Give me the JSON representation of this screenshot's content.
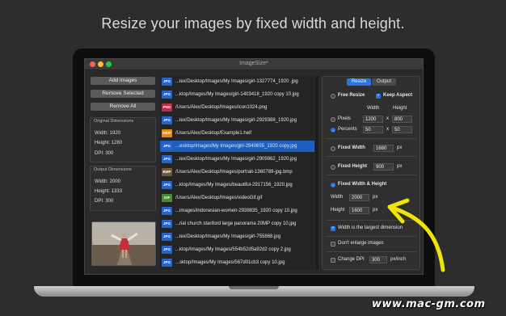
{
  "headline": "Resize your images by fixed width and height.",
  "window": {
    "title": "ImageSize*"
  },
  "buttons": {
    "add": "Add Images",
    "remove_selected": "Remove Selected",
    "remove_all": "Remove All"
  },
  "original": {
    "title": "Original Dimensions",
    "width": "Width: 1920",
    "height": "Height: 1280",
    "dpi": "DPI: 300"
  },
  "output": {
    "title": "Output Dimensions",
    "width": "Width: 2000",
    "height": "Height: 1333",
    "dpi": "DPI: 300"
  },
  "files": [
    {
      "type": "JPG",
      "path": "...lex/Desktop/Images/My Images/girl-1327774_1920 .jpg",
      "color": "#2b63c7"
    },
    {
      "type": "JPG",
      "path": "...ktop/Images/My Images/girl-1403418_1920 copy 10.jpg",
      "color": "#2b63c7"
    },
    {
      "type": "PNG",
      "path": "/Users/Alex/Desktop/Images/icon1024.png",
      "color": "#b8314a"
    },
    {
      "type": "JPG",
      "path": "...lex/Desktop/Images/My Images/girl-2929388_1920.jpg",
      "color": "#2b63c7"
    },
    {
      "type": "HEIF",
      "path": "/Users/Alex/Desktop/Example1.heif",
      "color": "#e08a22"
    },
    {
      "type": "JPG",
      "path": "...esktop/Images/My Images/girl-2940655_1920 copy.jpg",
      "color": "#2b63c7"
    },
    {
      "type": "JPG",
      "path": "...lex/Desktop/Images/My Images/girl-2909862_1920.jpg",
      "color": "#2b63c7"
    },
    {
      "type": "BMP",
      "path": "/Users/Alex/Desktop/Images/portrait-1360789-jpg.bmp",
      "color": "#6d5a3a"
    },
    {
      "type": "JPG",
      "path": "...ktop/Images/My Images/beautiful-2917156_1920.jpg",
      "color": "#2b63c7"
    },
    {
      "type": "GIF",
      "path": "/Users/Alex/Desktop/Images/videoGif.gif",
      "color": "#4a8a3a"
    },
    {
      "type": "JPG",
      "path": "...images/indonesian-women-2939835_1920 copy 10.jpg",
      "color": "#2b63c7"
    },
    {
      "type": "JPG",
      "path": "...rial church stanford large panorama 20MP copy 10.jpg",
      "color": "#2b63c7"
    },
    {
      "type": "JPG",
      "path": "...lex/Desktop/Images/My Images/girl-755868.jpg",
      "color": "#2b63c7"
    },
    {
      "type": "JPG",
      "path": "...ktop/Images/My Images/554b52d5a92d2 copy 2.jpg",
      "color": "#2b63c7"
    },
    {
      "type": "JPG",
      "path": "...sktop/Images/My Images/567d01cb3 copy 10.jpg",
      "color": "#2b63c7"
    }
  ],
  "selected_index": 5,
  "tabs": {
    "resize": "Resize",
    "output": "Output"
  },
  "settings": {
    "free_resize": "Free Resize",
    "keep_aspect": "Keep Aspect",
    "col_width": "Width",
    "col_height": "Height",
    "pixels": "Pixels",
    "pixels_w": "1200",
    "pixels_h": "800",
    "percents": "Percents",
    "percents_w": "50",
    "percents_h": "50",
    "x": "x",
    "fixed_width": "Fixed Width",
    "fixed_width_value": "1680",
    "fixed_height": "Fixed Height",
    "fixed_height_value": "900",
    "px": "px",
    "fixed_wh": "Fixed Width & Height",
    "width_label": "Width",
    "width_value": "2000",
    "height_label": "Height",
    "height_value": "1600",
    "largest_dim": "Width is the largest dimension",
    "dont_enlarge": "Don't enlarge images",
    "change_dpi": "Change DPI",
    "dpi_value": "300",
    "px_inch": "px/inch"
  },
  "watermark": "www.mac-gm.com",
  "colors": {
    "accent": "#2a74e0",
    "highlight": "#1d5fbf",
    "arrow": "#f2e30b"
  }
}
